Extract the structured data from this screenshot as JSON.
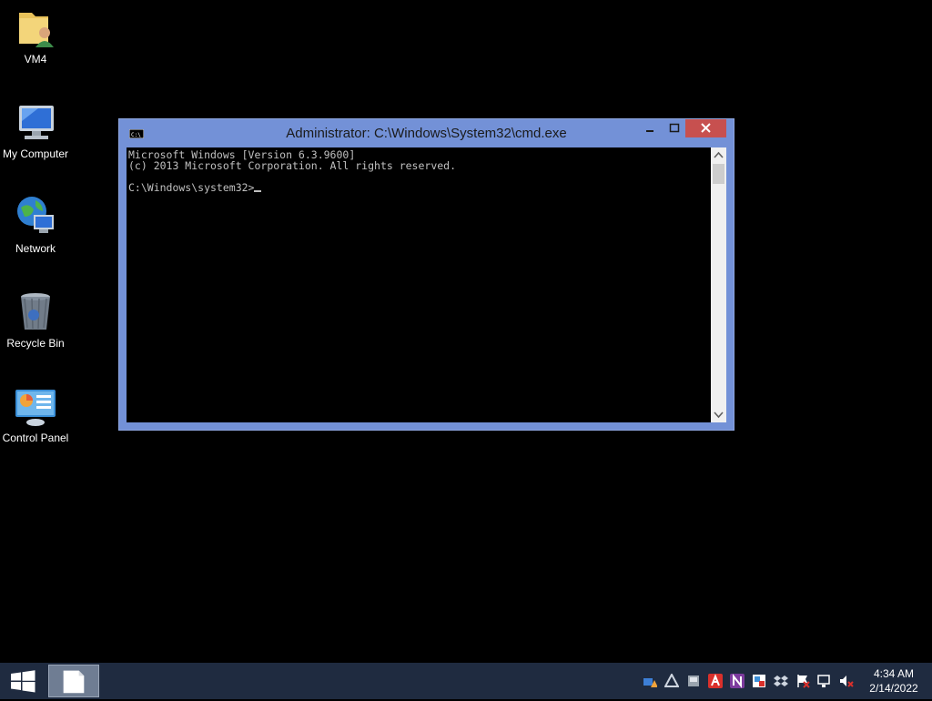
{
  "desktop": {
    "icons": [
      {
        "label": "VM4",
        "icon": "user-folder-icon"
      },
      {
        "label": "My Computer",
        "icon": "computer-icon"
      },
      {
        "label": "Network",
        "icon": "network-icon"
      },
      {
        "label": "Recycle Bin",
        "icon": "recycle-bin-icon"
      },
      {
        "label": "Control Panel",
        "icon": "control-panel-icon"
      }
    ]
  },
  "window": {
    "title": "Administrator: C:\\Windows\\System32\\cmd.exe",
    "icon": "cmd-icon",
    "controls": {
      "minimize": "minimize-icon",
      "maximize": "maximize-icon",
      "close": "close-icon"
    },
    "console": {
      "lines": [
        "Microsoft Windows [Version 6.3.9600]",
        "(c) 2013 Microsoft Corporation. All rights reserved.",
        "",
        "C:\\Windows\\system32>"
      ]
    }
  },
  "taskbar": {
    "start_icon": "windows-logo-icon",
    "tray_icons": [
      "network-alert-icon",
      "arrows-icon",
      "device-icon",
      "antivirus-icon",
      "onenote-icon",
      "image-icon",
      "dropbox-icon",
      "action-center-flag-icon",
      "display-icon",
      "volume-muted-icon"
    ],
    "clock": {
      "time": "4:34 AM",
      "date": "2/14/2022"
    }
  },
  "colors": {
    "window_frame": "#7391d7",
    "close_button": "#c7504f",
    "taskbar": "#1f2b40"
  }
}
